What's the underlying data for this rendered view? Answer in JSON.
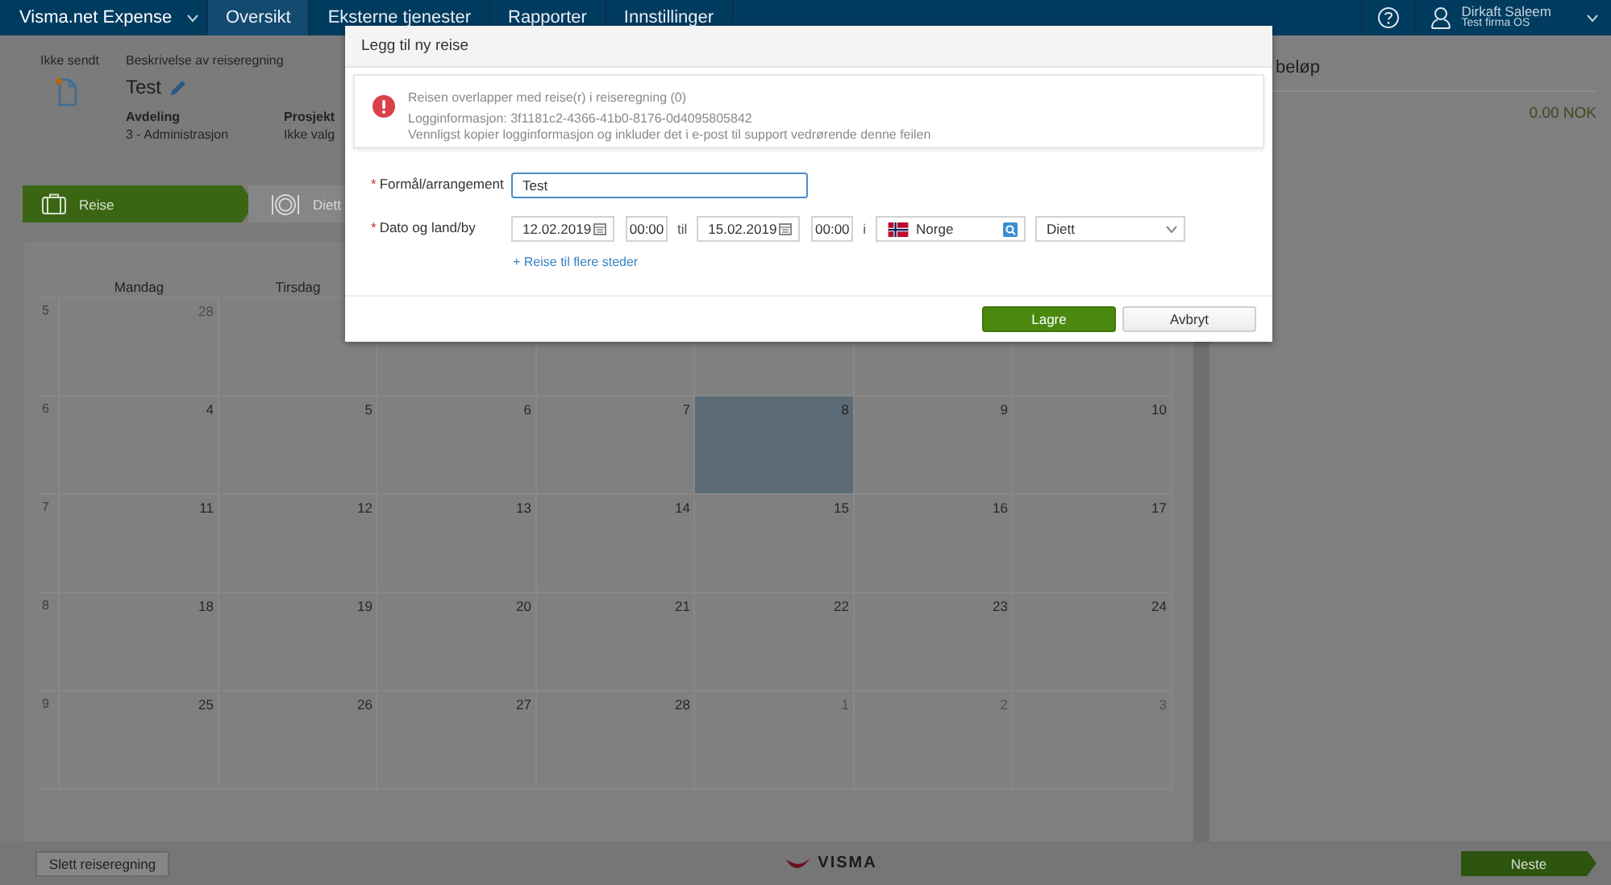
{
  "nav": {
    "brand": "Visma.net Expense",
    "tabs": [
      {
        "label": "Oversikt",
        "selected": true
      },
      {
        "label": "Eksterne tjenester",
        "selected": false
      },
      {
        "label": "Rapporter",
        "selected": false
      },
      {
        "label": "Innstillinger",
        "selected": false
      }
    ],
    "user": {
      "name": "Dirkaft Saleem",
      "company": "Test firma OS"
    }
  },
  "report": {
    "status": "Ikke sendt",
    "description_label": "Beskrivelse av reiseregning",
    "description": "Test",
    "fields": [
      {
        "label": "Avdeling",
        "value": "3 - Administrasjon"
      },
      {
        "label": "Prosjekt",
        "value": "Ikke valg"
      }
    ]
  },
  "steps": [
    {
      "label": "Reise",
      "selected": true
    },
    {
      "label": "Diett",
      "selected": false
    }
  ],
  "summary": {
    "title": "beløp",
    "total": "0.00 NOK"
  },
  "calendar": {
    "weekdays": [
      "Mandag",
      "Tirsdag"
    ],
    "weeks": [
      {
        "number": "5",
        "days": [
          {
            "label": "28",
            "outside": true,
            "selected": false
          }
        ]
      },
      {
        "number": "6",
        "days": [
          {
            "label": "4",
            "outside": false,
            "selected": false
          },
          {
            "label": "5",
            "outside": false,
            "selected": false
          },
          {
            "label": "6",
            "outside": false,
            "selected": false
          },
          {
            "label": "7",
            "outside": false,
            "selected": false
          },
          {
            "label": "8",
            "outside": false,
            "selected": true
          },
          {
            "label": "9",
            "outside": false,
            "selected": false
          },
          {
            "label": "10",
            "outside": false,
            "selected": false
          }
        ]
      },
      {
        "number": "7",
        "days": [
          {
            "label": "11",
            "outside": false,
            "selected": false
          },
          {
            "label": "12",
            "outside": false,
            "selected": false
          },
          {
            "label": "13",
            "outside": false,
            "selected": false
          },
          {
            "label": "14",
            "outside": false,
            "selected": false
          },
          {
            "label": "15",
            "outside": false,
            "selected": false
          },
          {
            "label": "16",
            "outside": false,
            "selected": false
          },
          {
            "label": "17",
            "outside": false,
            "selected": false
          }
        ]
      },
      {
        "number": "8",
        "days": [
          {
            "label": "18",
            "outside": false,
            "selected": false
          },
          {
            "label": "19",
            "outside": false,
            "selected": false
          },
          {
            "label": "20",
            "outside": false,
            "selected": false
          },
          {
            "label": "21",
            "outside": false,
            "selected": false
          },
          {
            "label": "22",
            "outside": false,
            "selected": false
          },
          {
            "label": "23",
            "outside": false,
            "selected": false
          },
          {
            "label": "24",
            "outside": false,
            "selected": false
          }
        ]
      },
      {
        "number": "9",
        "days": [
          {
            "label": "25",
            "outside": false,
            "selected": false
          },
          {
            "label": "26",
            "outside": false,
            "selected": false
          },
          {
            "label": "27",
            "outside": false,
            "selected": false
          },
          {
            "label": "28",
            "outside": false,
            "selected": false
          },
          {
            "label": "1",
            "outside": true,
            "selected": false
          },
          {
            "label": "2",
            "outside": true,
            "selected": false
          },
          {
            "label": "3",
            "outside": true,
            "selected": false
          }
        ]
      }
    ]
  },
  "dialog": {
    "title": "Legg til ny reise",
    "alert": {
      "message": "Reisen overlapper med reise(r) i reiseregning (0)",
      "log": "Logginformasjon: 3f1181c2-4366-41b0-8176-0d4095805842",
      "hint": "Vennligst kopier logginformasjon og inkluder det i e-post til support vedrørende denne feilen"
    },
    "purpose": {
      "required_mark": "*",
      "label": "Formål/arrangement",
      "value": "Test",
      "focused": true
    },
    "dates": {
      "required_mark": "*",
      "label": "Dato og land/by",
      "from_date": "12.02.2019",
      "from_time": "00:00",
      "to_word": "til",
      "to_date": "15.02.2019",
      "to_time": "00:00",
      "in_word": "i",
      "country": "Norge",
      "allowance": "Diett"
    },
    "add_link": "+ Reise til flere steder",
    "buttons": [
      {
        "label": "Lagre",
        "kind": "primary"
      },
      {
        "label": "Avbryt",
        "kind": "secondary"
      }
    ]
  },
  "footer": {
    "delete": "Slett reiseregning",
    "logo": "VISMA",
    "next": "Neste"
  }
}
